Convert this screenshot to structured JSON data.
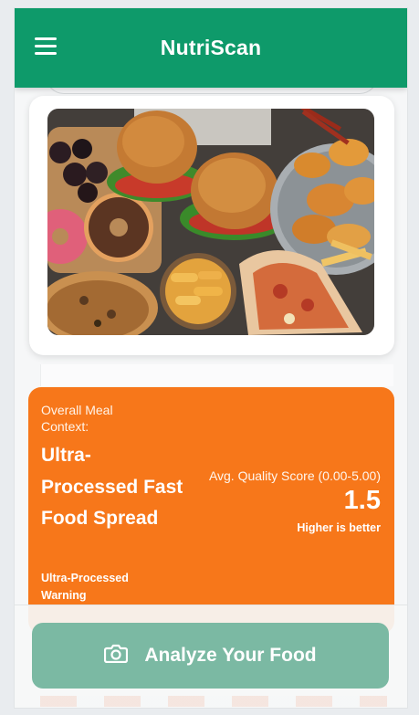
{
  "app": {
    "title": "NutriScan"
  },
  "icons": {
    "menu": "hamburger-menu-icon",
    "camera": "camera-icon"
  },
  "colors": {
    "appbar": "#0e9a6a",
    "context_card": "#f7771a",
    "analyze_button": "#7bb9a3"
  },
  "meal_context": {
    "label": "Overall Meal Context:",
    "title": "Ultra-Processed Fast Food Spread",
    "warning": "Ultra-Processed Warning",
    "score_label": "Avg. Quality Score (0.00-5.00)",
    "score_value": "1.5",
    "score_hint": "Higher is better"
  },
  "actions": {
    "analyze_label": "Analyze Your Food"
  }
}
